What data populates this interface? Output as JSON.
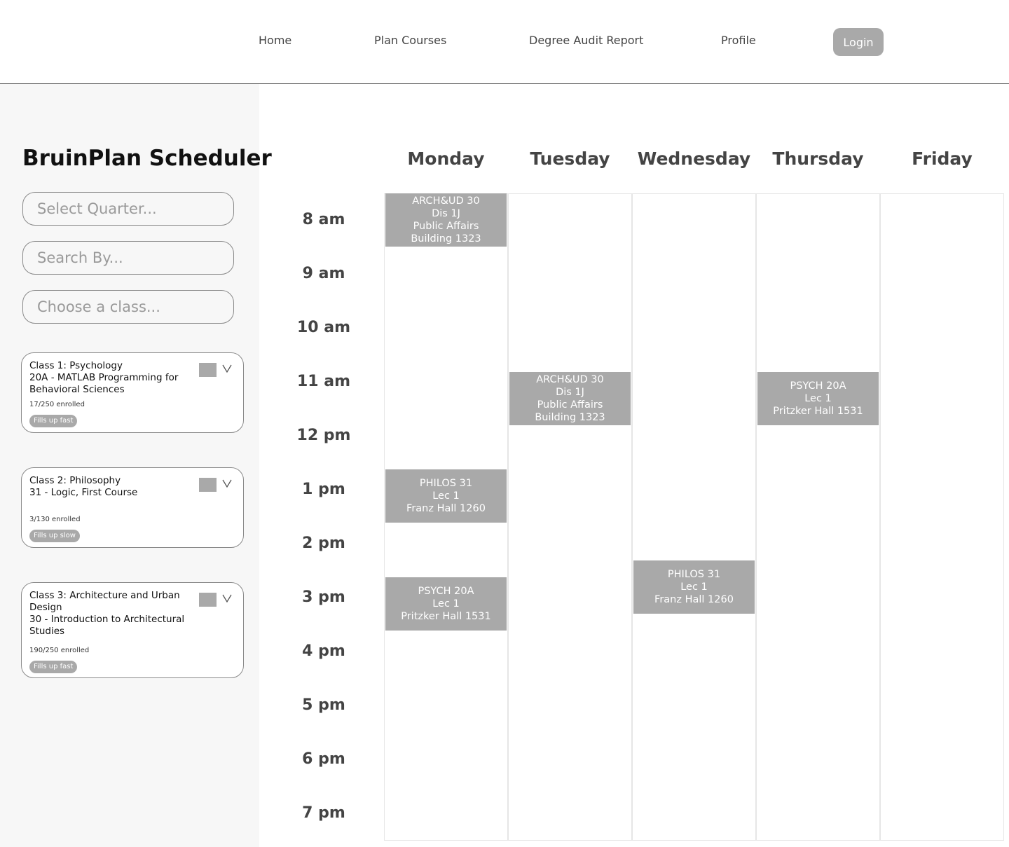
{
  "nav": {
    "home": "Home",
    "plan_courses": "Plan Courses",
    "degree_audit": "Degree Audit Report",
    "profile": "Profile",
    "login": "Login"
  },
  "sidebar": {
    "title": "BruinPlan Scheduler",
    "select_quarter_placeholder": "Select Quarter...",
    "search_by_placeholder": "Search By...",
    "choose_class_placeholder": "Choose a class...",
    "classes": [
      {
        "title": "Class 1: Psychology\n20A - MATLAB Programming for Behavioral Sciences",
        "enrolled": "17/250 enrolled",
        "badge": "Fills up fast"
      },
      {
        "title": "Class 2: Philosophy\n31 - Logic, First Course",
        "enrolled": "3/130 enrolled",
        "badge": "Fills up slow"
      },
      {
        "title": "Class 3: Architecture and Urban Design\n30 - Introduction to Architectural Studies",
        "enrolled": "190/250 enrolled",
        "badge": "Fills up fast"
      }
    ]
  },
  "calendar": {
    "days": [
      "Monday",
      "Tuesday",
      "Wednesday",
      "Thursday",
      "Friday"
    ],
    "times": [
      "8 am",
      "9 am",
      "10 am",
      "11 am",
      "12 pm",
      "1 pm",
      "2 pm",
      "3 pm",
      "4 pm",
      "5 pm",
      "6 pm",
      "7 pm"
    ],
    "events": [
      {
        "day": "Monday",
        "start": "8 am",
        "lines": [
          "ARCH&UD 30",
          "Dis 1J",
          "Public Affairs",
          "Building 1323"
        ]
      },
      {
        "day": "Tuesday",
        "start": "11 am",
        "lines": [
          "ARCH&UD 30",
          "Dis 1J",
          "Public Affairs",
          "Building 1323"
        ]
      },
      {
        "day": "Thursday",
        "start": "11 am",
        "lines": [
          "PSYCH 20A",
          "Lec 1",
          "Pritzker Hall 1531"
        ]
      },
      {
        "day": "Monday",
        "start": "1 pm",
        "lines": [
          "PHILOS 31",
          "Lec 1",
          "Franz Hall 1260"
        ]
      },
      {
        "day": "Monday",
        "start": "3 pm",
        "lines": [
          "PSYCH 20A",
          "Lec 1",
          "Pritzker Hall 1531"
        ]
      },
      {
        "day": "Wednesday",
        "start": "3 pm",
        "lines": [
          "PHILOS 31",
          "Lec 1",
          "Franz Hall 1260"
        ]
      }
    ]
  },
  "colors": {
    "event_fill": "#a9a9a9",
    "button_fill": "#a9a9a9",
    "sidebar_bg": "#f7f7f7"
  }
}
